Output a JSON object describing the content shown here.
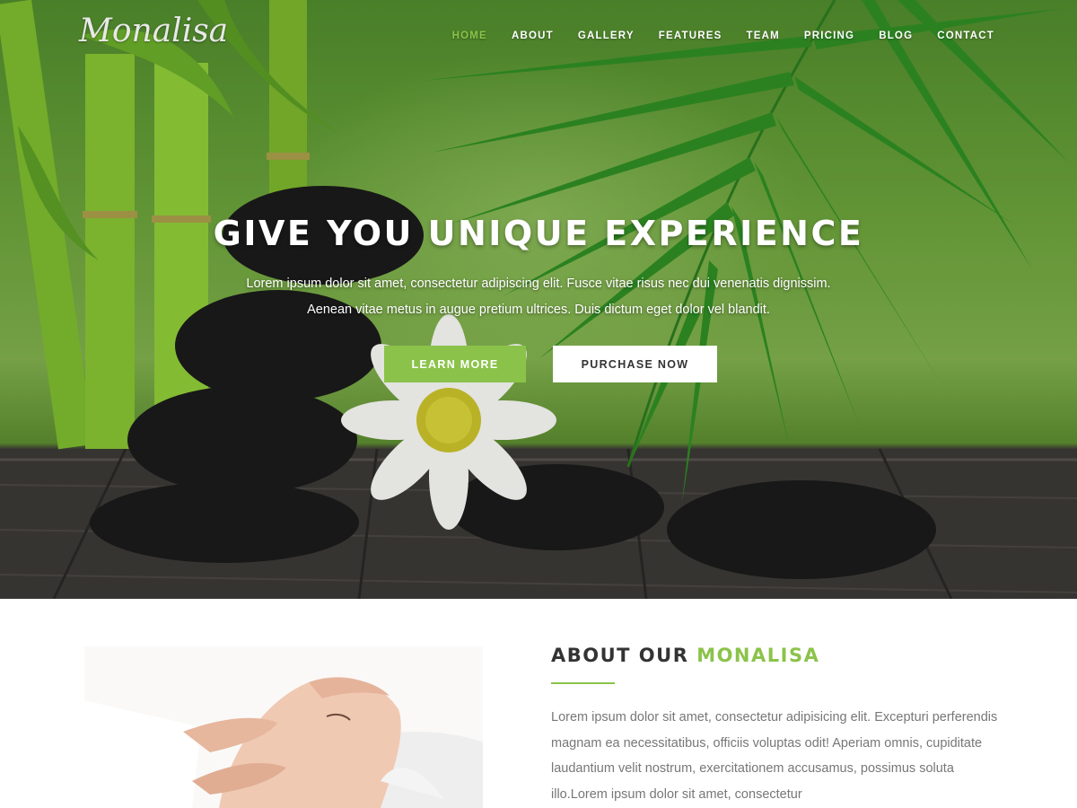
{
  "brand": {
    "logo_text": "Monalisa"
  },
  "nav": {
    "items": [
      {
        "label": "HOME",
        "active": true
      },
      {
        "label": "ABOUT",
        "active": false
      },
      {
        "label": "GALLERY",
        "active": false
      },
      {
        "label": "FEATURES",
        "active": false
      },
      {
        "label": "TEAM",
        "active": false
      },
      {
        "label": "PRICING",
        "active": false
      },
      {
        "label": "BLOG",
        "active": false
      },
      {
        "label": "CONTACT",
        "active": false
      }
    ]
  },
  "hero": {
    "title": "GIVE YOU UNIQUE EXPERIENCE",
    "subtitle_line1": "Lorem ipsum dolor sit amet, consectetur adipiscing elit. Fusce vitae risus nec dui venenatis dignissim.",
    "subtitle_line2": "Aenean vitae metus in augue pretium ultrices. Duis dictum eget dolor vel blandit.",
    "learn_more_label": "LEARN MORE",
    "purchase_label": "PURCHASE NOW"
  },
  "about": {
    "title_prefix": "ABOUT OUR",
    "title_accent": "MONALISA",
    "body": "Lorem ipsum dolor sit amet, consectetur adipisicing elit. Excepturi perferendis magnam ea necessitatibus, officiis voluptas odit! Aperiam omnis, cupiditate laudantium velit nostrum, exercitationem accusamus, possimus soluta illo.Lorem ipsum dolor sit amet, consectetur"
  },
  "colors": {
    "accent": "#8bc34a",
    "heading": "#333333",
    "body_text": "#777777",
    "white": "#ffffff"
  }
}
